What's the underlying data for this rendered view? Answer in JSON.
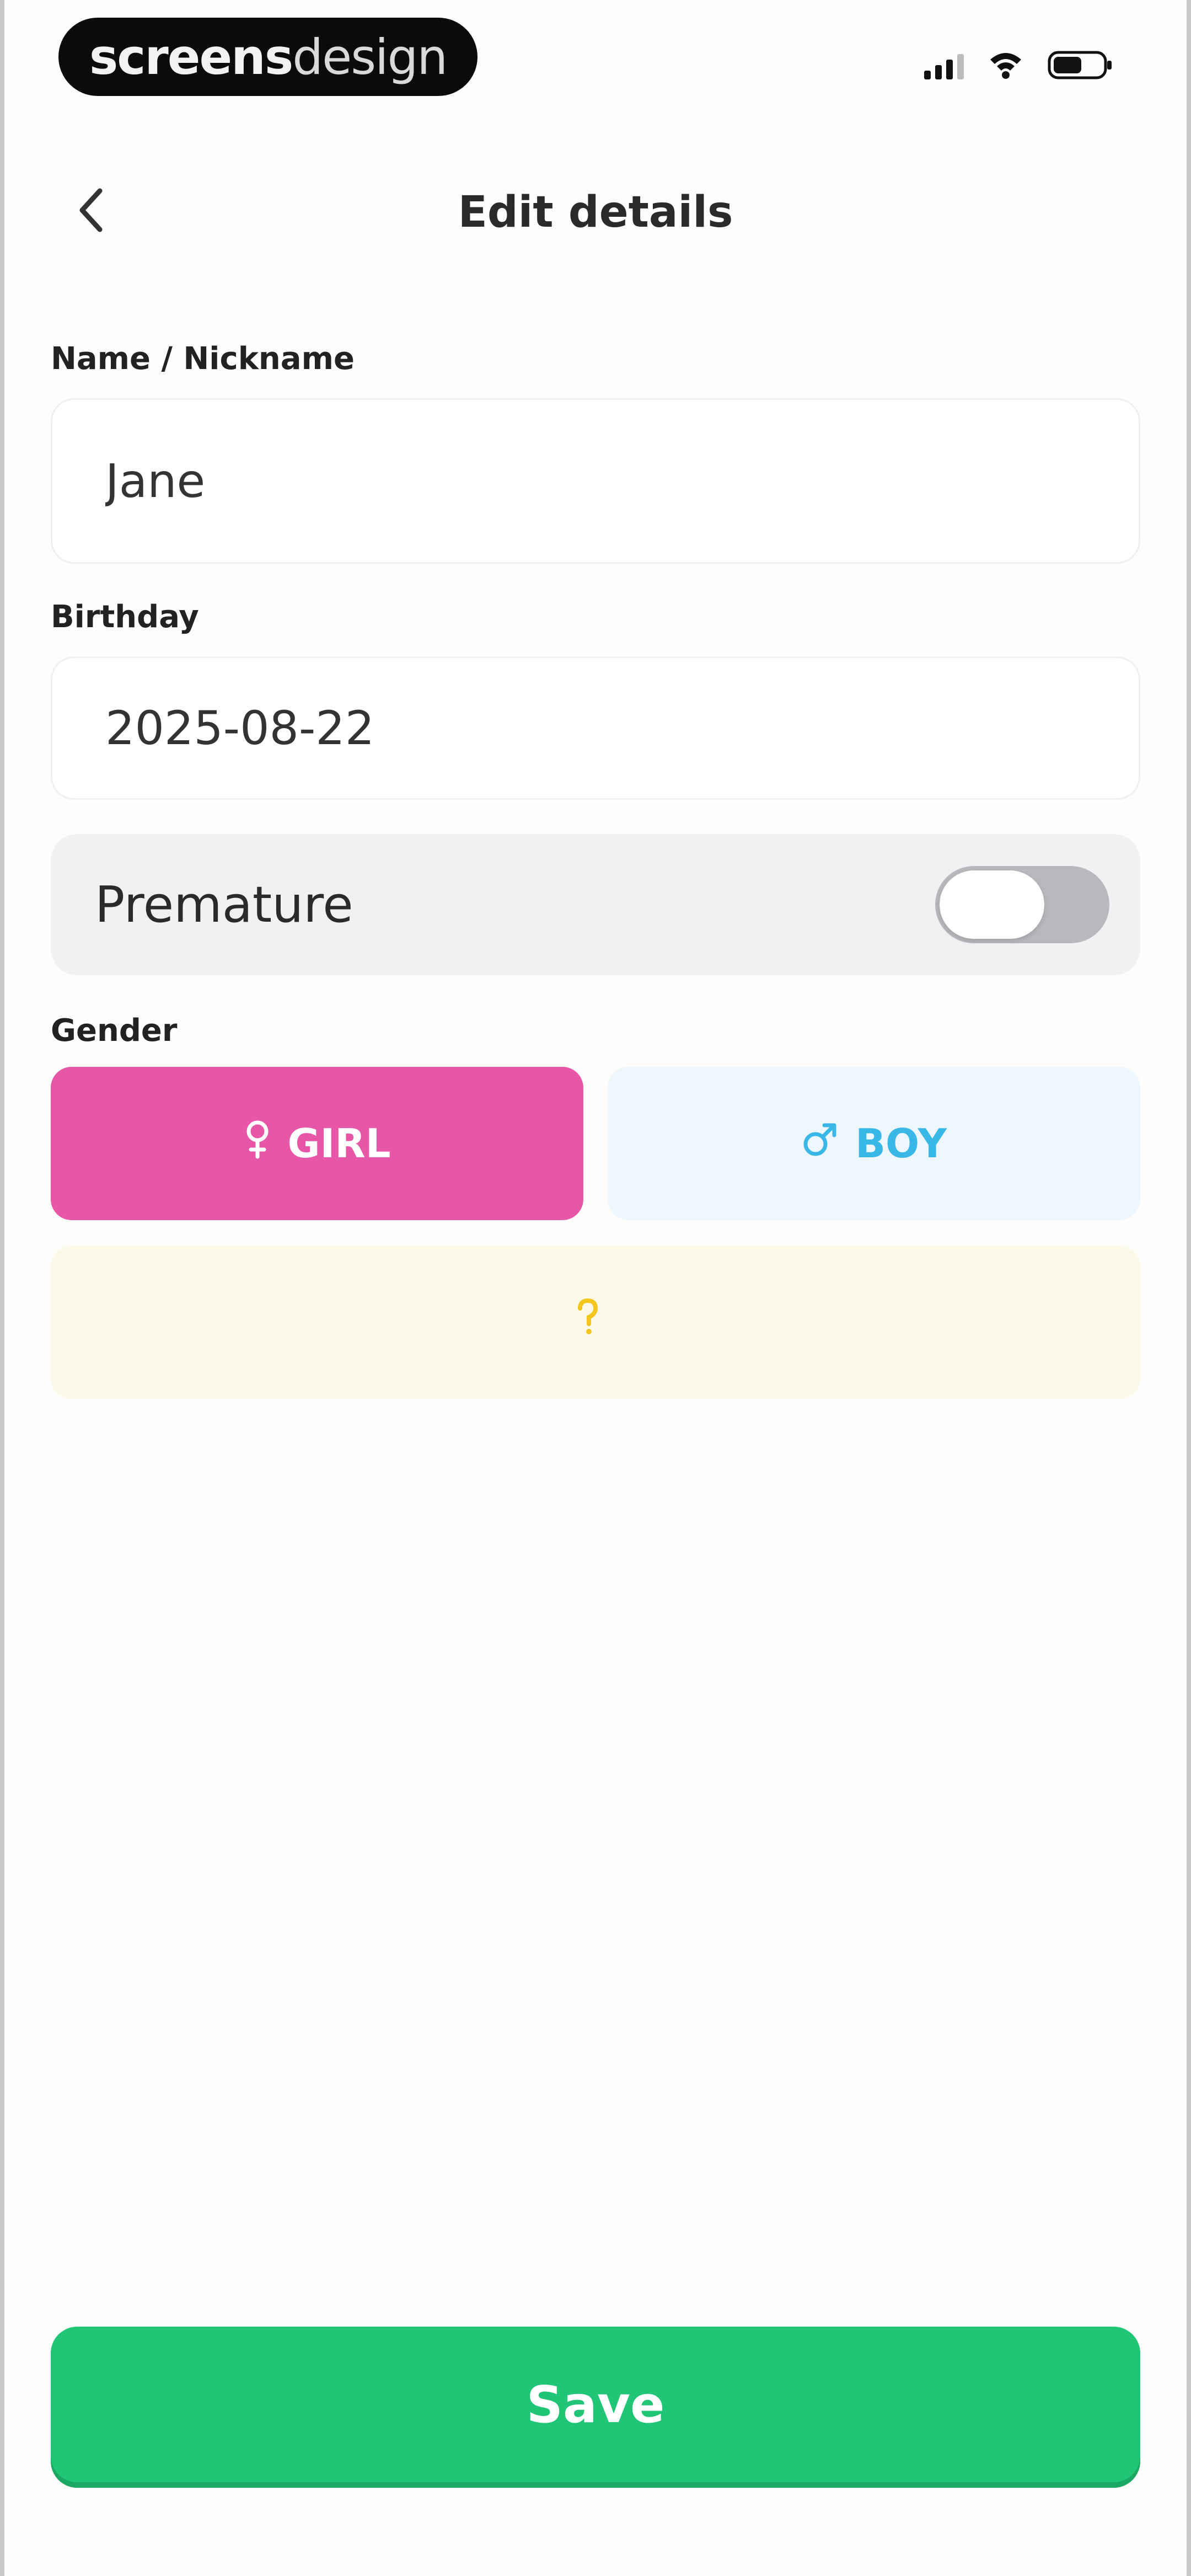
{
  "status_bar": {
    "watermark_bold": "screens",
    "watermark_light": "design",
    "icons": [
      "signal-icon",
      "wifi-icon",
      "battery-icon"
    ]
  },
  "header": {
    "title": "Edit details",
    "back_icon": "chevron-left-icon"
  },
  "form": {
    "name_label": "Name / Nickname",
    "name_value": "Jane",
    "birthday_label": "Birthday",
    "birthday_value": "2025-08-22",
    "premature_label": "Premature",
    "premature_on": false,
    "gender_label": "Gender",
    "gender_options": [
      {
        "label": "GIRL",
        "icon": "female-icon",
        "selected": true,
        "color": "#e857a7"
      },
      {
        "label": "BOY",
        "icon": "male-icon",
        "selected": false,
        "color": "#39b8e8"
      },
      {
        "label": "",
        "icon": "question-mark-icon",
        "selected": false,
        "color": "#f2c61f"
      }
    ]
  },
  "footer": {
    "save_label": "Save",
    "save_color": "#20c575"
  }
}
